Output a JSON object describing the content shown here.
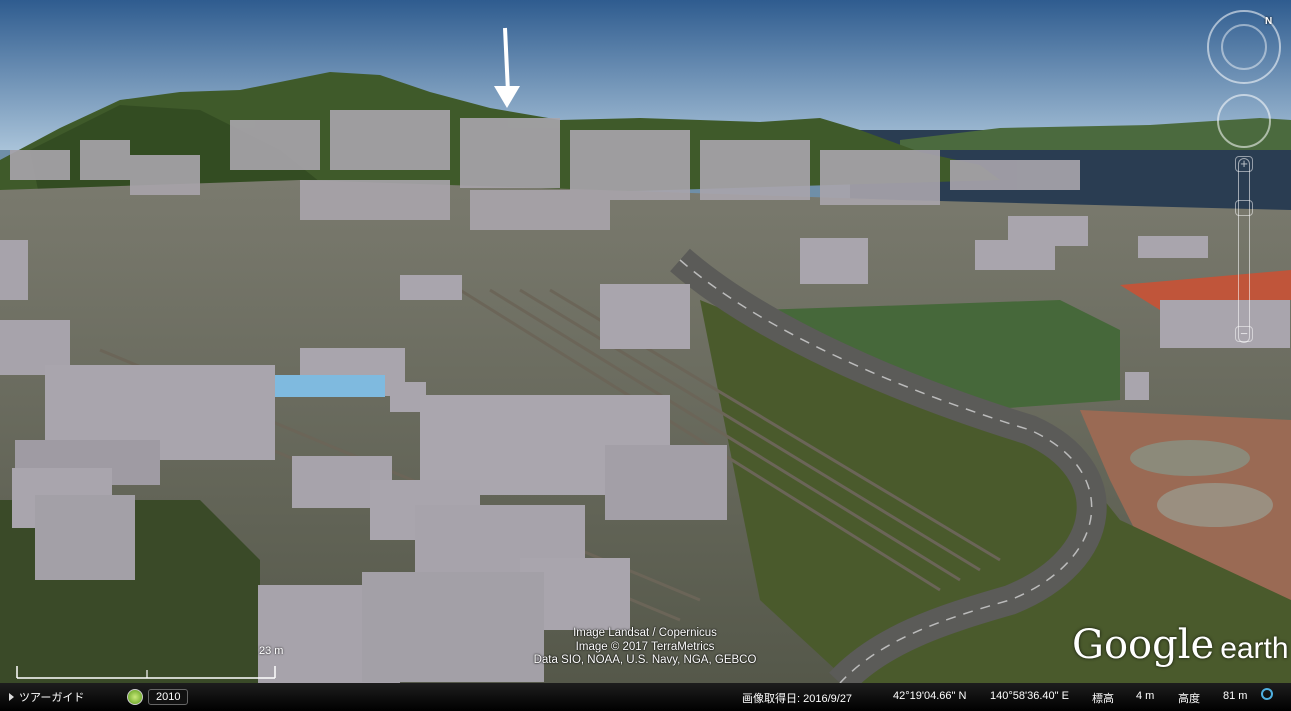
{
  "attribution": {
    "line1": "Image Landsat / Copernicus",
    "line2": "Image © 2017 TerraMetrics",
    "line3": "Data SIO, NOAA, U.S. Navy, NGA, GEBCO"
  },
  "logo": {
    "brand": "Google",
    "product": "earth"
  },
  "scale": {
    "label": "23 m"
  },
  "statusbar": {
    "tour_label": "ツアーガイド",
    "history_year": "2010",
    "imagery_date": "画像取得日: 2016/9/27",
    "latitude": "42°19'04.66\" N",
    "longitude": "140°58'36.40\" E",
    "elevation_label": "標高",
    "elevation_value": "4 m",
    "altitude_label": "高度",
    "altitude_value": "81 m"
  },
  "navigation": {
    "compass_north": "N"
  },
  "colors": {
    "sky_top": "#2f5c8f",
    "sky_bottom": "#a9c3d9",
    "building": "#a9a5ac",
    "water": "#2a3d52",
    "vegetation": "#3f5a2a",
    "track": "#c0553a"
  }
}
